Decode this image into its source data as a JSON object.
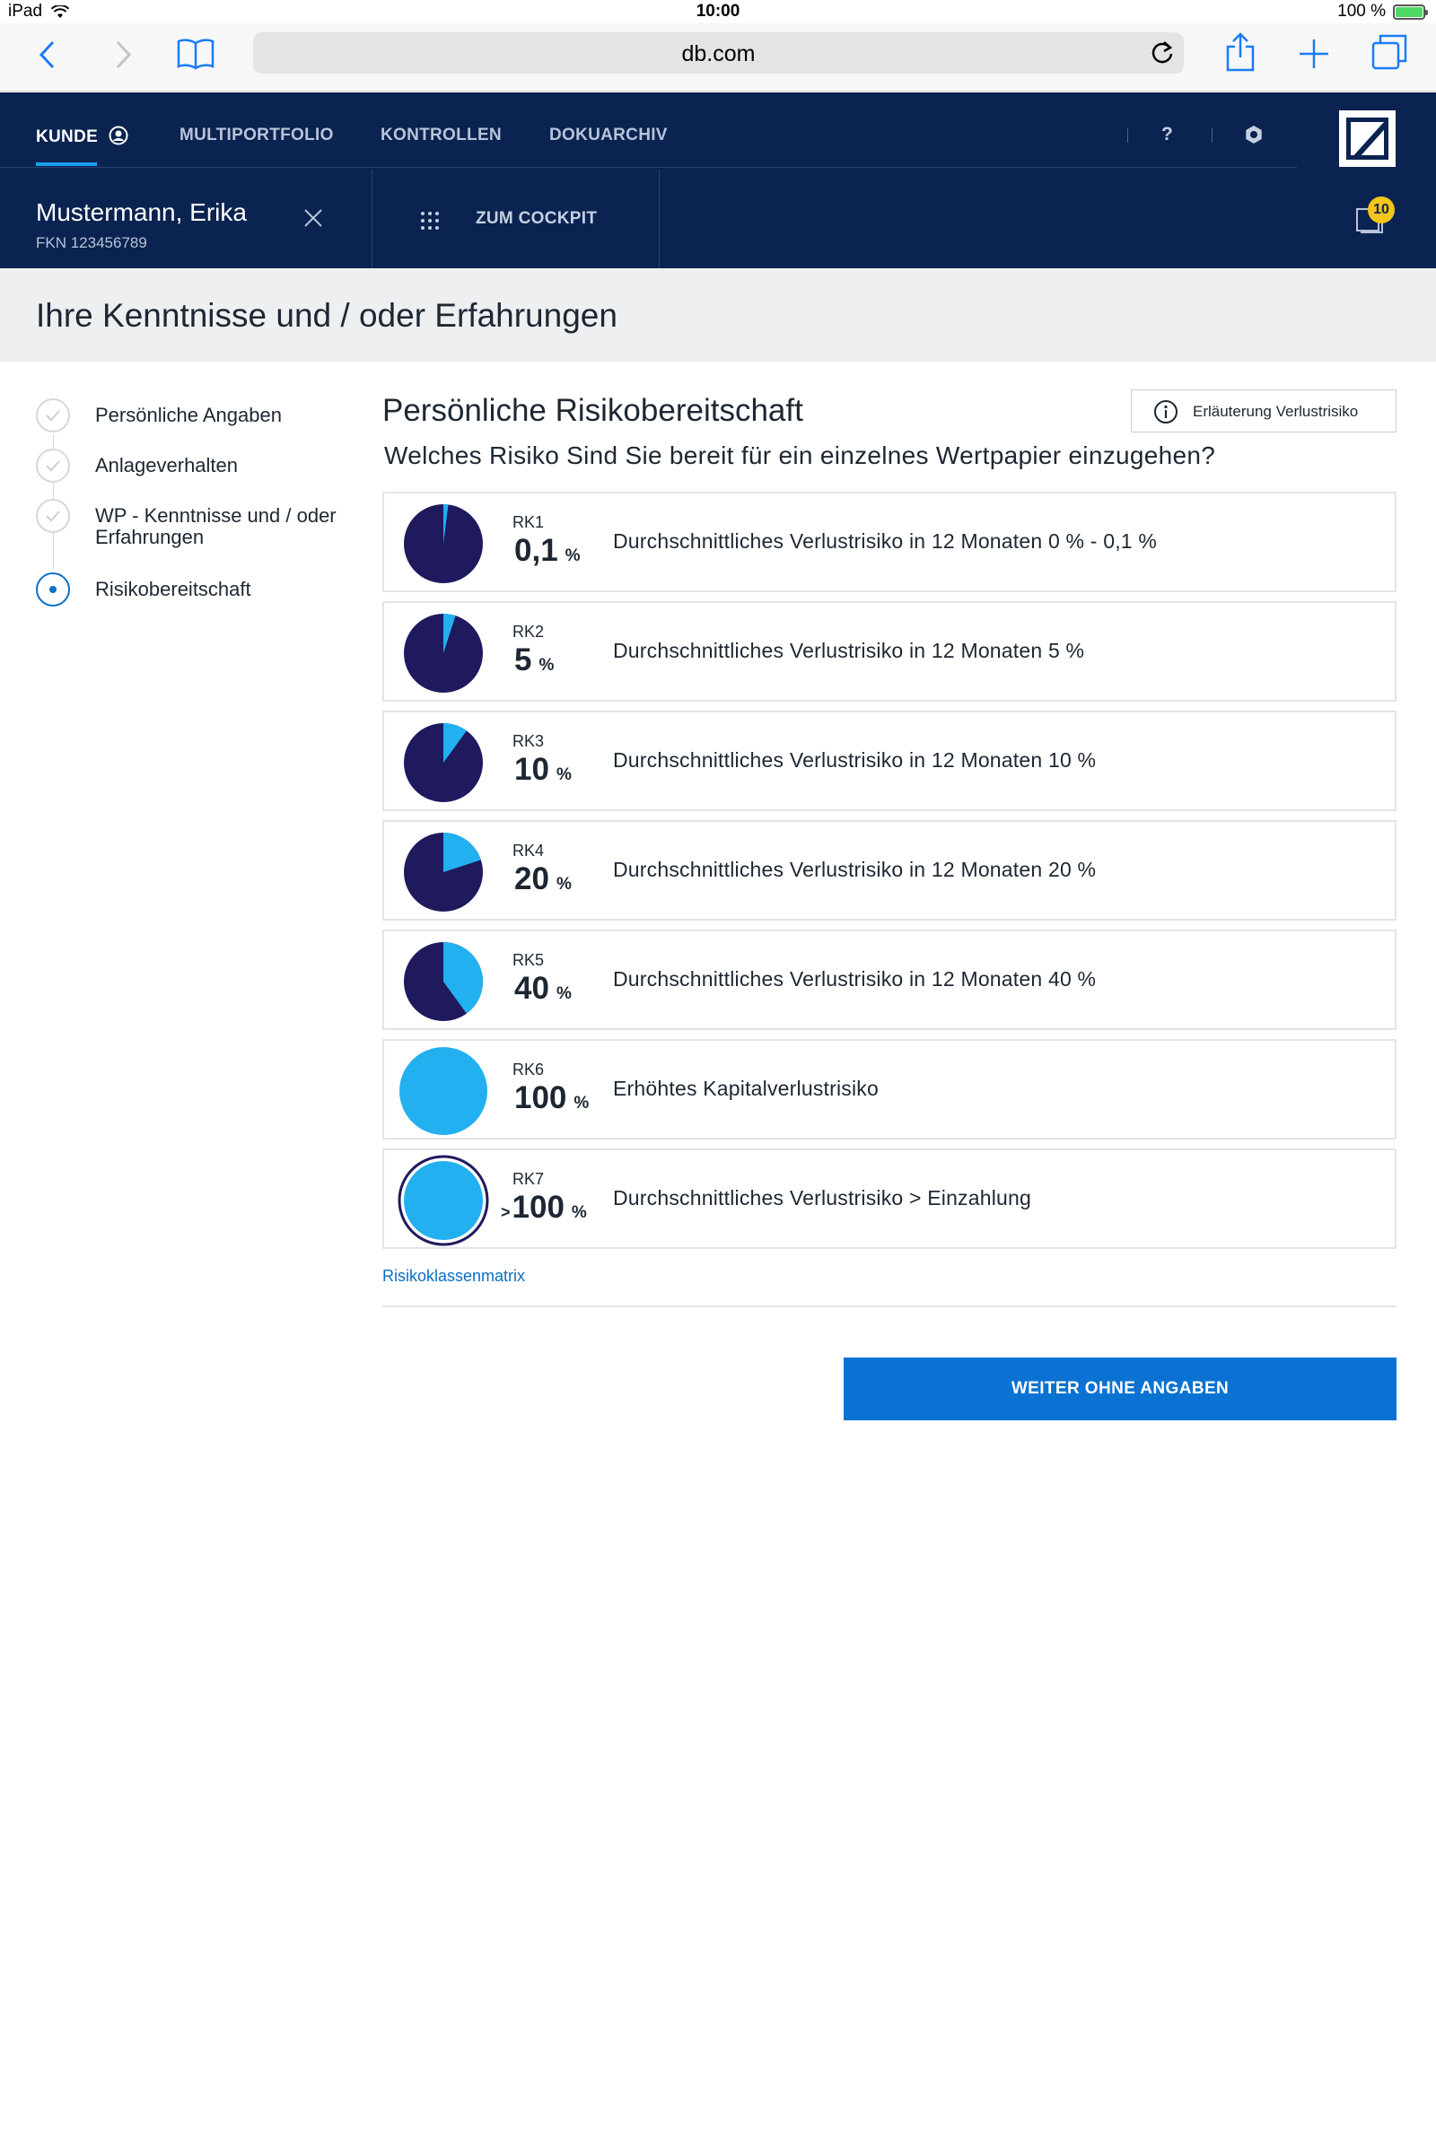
{
  "status_bar": {
    "device": "iPad",
    "time": "10:00",
    "battery": "100 %"
  },
  "browser": {
    "url": "db.com"
  },
  "nav": {
    "items": [
      {
        "label": "KUNDE",
        "active": true
      },
      {
        "label": "MULTIPORTFOLIO",
        "active": false
      },
      {
        "label": "KONTROLLEN",
        "active": false
      },
      {
        "label": "DOKUARCHIV",
        "active": false
      }
    ],
    "help": "?"
  },
  "customer": {
    "name": "Mustermann, Erika",
    "fkn": "FKN 123456789",
    "cockpit": "ZUM COCKPIT",
    "notifications": "10"
  },
  "page": {
    "title": "Ihre Kenntnisse und / oder Erfahrungen"
  },
  "stepper": {
    "steps": [
      {
        "label": "Persönliche Angaben",
        "state": "done"
      },
      {
        "label": "Anlageverhalten",
        "state": "done"
      },
      {
        "label": "WP - Kenntnisse und / oder Erfahrungen",
        "state": "done"
      },
      {
        "label": "Risikobereitschaft",
        "state": "current"
      }
    ]
  },
  "main": {
    "section_title": "Persönliche Risikobereitschaft",
    "info_button": "Erläuterung Verlustrisiko",
    "question": "Welches Risiko Sind Sie bereit für ein einzelnes Wertpapier einzugehen?",
    "options": [
      {
        "code": "RK1",
        "prefix": "",
        "value": "0,1",
        "unit": "%",
        "fraction": 0.02,
        "description": "Durchschnittliches Verlustrisiko in 12 Monaten 0 % - 0,1 %"
      },
      {
        "code": "RK2",
        "prefix": "",
        "value": "5",
        "unit": "%",
        "fraction": 0.05,
        "description": "Durchschnittliches Verlustrisiko in 12 Monaten 5 %"
      },
      {
        "code": "RK3",
        "prefix": "",
        "value": "10",
        "unit": "%",
        "fraction": 0.1,
        "description": "Durchschnittliches Verlustrisiko in 12 Monaten 10 %"
      },
      {
        "code": "RK4",
        "prefix": "",
        "value": "20",
        "unit": "%",
        "fraction": 0.2,
        "description": "Durchschnittliches Verlustrisiko in 12 Monaten 20 %"
      },
      {
        "code": "RK5",
        "prefix": "",
        "value": "40",
        "unit": "%",
        "fraction": 0.4,
        "description": "Durchschnittliches Verlustrisiko in 12 Monaten 40 %"
      },
      {
        "code": "RK6",
        "prefix": "",
        "value": "100",
        "unit": "%",
        "fraction": 1.0,
        "description": "Erhöhtes Kapitalverlustrisiko"
      },
      {
        "code": "RK7",
        "prefix": ">",
        "value": "100",
        "unit": "%",
        "fraction": 1.0,
        "description": "Durchschnittliches Verlustrisiko > Einzahlung"
      }
    ],
    "matrix_link": "Risikoklassenmatrix",
    "primary_button": "WEITER OHNE ANGABEN"
  },
  "colors": {
    "navy": "#0b2350",
    "pie_dark": "#1f1a5e",
    "pie_light": "#22b0f0",
    "primary": "#0a72d3"
  }
}
